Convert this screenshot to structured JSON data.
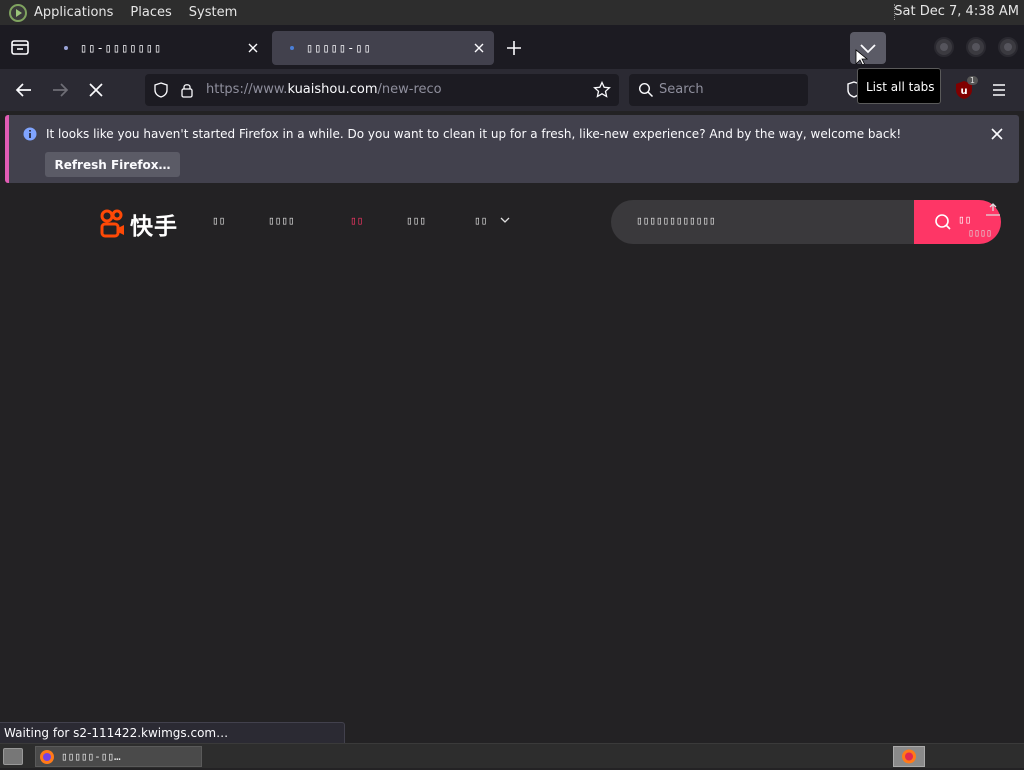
{
  "top_panel": {
    "menus": [
      "Applications",
      "Places",
      "System"
    ],
    "clock": "Sat Dec  7,  4:38 AM"
  },
  "tabs": [
    {
      "title": "▯▯-▯▯▯▯▯▯▯",
      "active": false
    },
    {
      "title": "▯▯▯▯▯-▯▯",
      "active": true
    }
  ],
  "toolbar": {
    "url_prefix": "https://www.",
    "url_domain": "kuaishou.com",
    "url_path": "/new-reco",
    "search_placeholder": "Search",
    "tooltip": "List all tabs",
    "ublock_badge": "1"
  },
  "notification": {
    "message": "It looks like you haven't started Firefox in a while. Do you want to clean it up for a fresh, like-new experience? And by the way, welcome back!",
    "button_label": "Refresh Firefox…"
  },
  "page": {
    "logo_text": "快手",
    "nav": [
      {
        "label": "▯▯",
        "active": false
      },
      {
        "label": "▯▯▯▯",
        "active": false
      },
      {
        "label": "▯▯",
        "active": true
      },
      {
        "label": "▯▯▯",
        "active": false
      },
      {
        "label": "▯▯",
        "active": false
      }
    ],
    "search_placeholder": "▯▯▯▯▯▯▯▯▯▯▯▯",
    "search_button": "▯▯",
    "upload_label": "▯▯▯▯"
  },
  "status_text": "Waiting for s2-111422.kwimgs.com…",
  "taskbar": {
    "window_title": "▯▯▯▯▯-▯▯…"
  },
  "colors": {
    "accent": "#fe3666",
    "toolbar": "#2b2a33",
    "tab_strip": "#1c1b22",
    "notification_stripe": "#e15cb4"
  }
}
